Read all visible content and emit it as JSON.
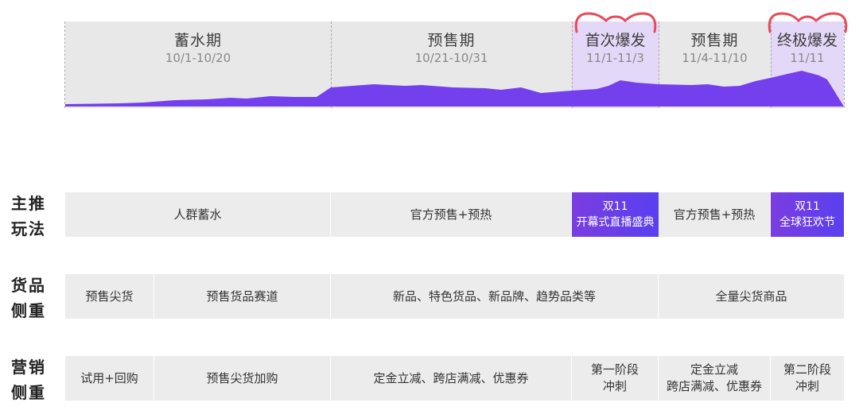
{
  "timeline": {
    "phases": [
      {
        "title": "蓄水期",
        "date": "10/1-10/20"
      },
      {
        "title": "预售期",
        "date": "10/21-10/31"
      },
      {
        "title": "首次爆发",
        "date": "11/1-11/3"
      },
      {
        "title": "预售期",
        "date": "11/4-11/10"
      },
      {
        "title": "终极爆发",
        "date": "11/11"
      }
    ]
  },
  "rows": {
    "play": {
      "label_line1": "主推",
      "label_line2": "玩法",
      "cells": [
        "人群蓄水",
        "官方预售+预热",
        "双11",
        "开幕式直播盛典",
        "官方预售+预热",
        "双11",
        "全球狂欢节"
      ]
    },
    "goods": {
      "label_line1": "货品",
      "label_line2": "侧重",
      "cells": [
        "预售尖货",
        "预售货品赛道",
        "新品、特色货品、新品牌、趋势品类等",
        "全量尖货商品"
      ]
    },
    "marketing": {
      "label_line1": "营销",
      "label_line2": "侧重",
      "cells": [
        "试用+回购",
        "预售尖货加购",
        "定金立减、跨店满减、优惠券",
        "第一阶段",
        "冲刺",
        "定金立减",
        "跨店满减、优惠券",
        "第二阶段",
        "冲刺"
      ]
    }
  },
  "colors": {
    "phase_gray": "#e8e8e8",
    "phase_purple": "#e4d8f8",
    "area_fill": "#7440ee",
    "accent_red": "#e84b5a",
    "cell_gray": "#ececec"
  }
}
